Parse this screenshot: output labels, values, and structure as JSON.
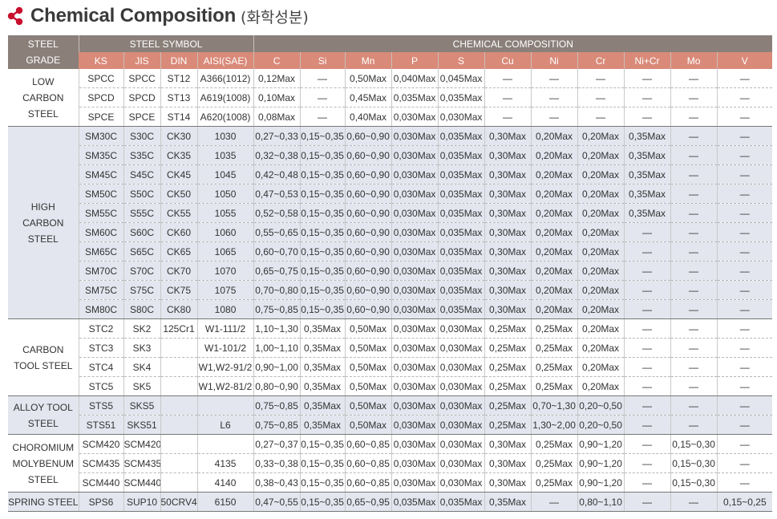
{
  "title": {
    "main": "Chemical Composition",
    "sub": "(화학성분)"
  },
  "header": {
    "steel_grade": [
      "STEEL",
      "GRADE"
    ],
    "steel_symbol": "STEEL SYMBOL",
    "chemical_composition": "CHEMICAL COMPOSITION",
    "columns": [
      "KS",
      "JIS",
      "DIN",
      "AISI(SAE)",
      "C",
      "Si",
      "Mn",
      "P",
      "S",
      "Cu",
      "Ni",
      "Cr",
      "Ni+Cr",
      "Mo",
      "V"
    ]
  },
  "groups": [
    {
      "grade": [
        "LOW",
        "CARBON",
        "STEEL"
      ],
      "shade": false,
      "rows": [
        [
          "SPCC",
          "SPCC",
          "ST12",
          "A366(1012)",
          "0,12Max",
          "—",
          "0,50Max",
          "0,040Max",
          "0,045Max",
          "—",
          "—",
          "—",
          "—",
          "—",
          "—"
        ],
        [
          "SPCD",
          "SPCD",
          "ST13",
          "A619(1008)",
          "0,10Max",
          "—",
          "0,45Max",
          "0,035Max",
          "0,035Max",
          "—",
          "—",
          "—",
          "—",
          "—",
          "—"
        ],
        [
          "SPCE",
          "SPCE",
          "ST14",
          "A620(1008)",
          "0,08Max",
          "—",
          "0,40Max",
          "0,030Max",
          "0,030Max",
          "—",
          "—",
          "—",
          "—",
          "—",
          "—"
        ]
      ]
    },
    {
      "grade": [
        "HIGH",
        "CARBON",
        "STEEL"
      ],
      "shade": true,
      "rows": [
        [
          "SM30C",
          "S30C",
          "CK30",
          "1030",
          "0,27~0,33",
          "0,15~0,35",
          "0,60~0,90",
          "0,030Max",
          "0,035Max",
          "0,30Max",
          "0,20Max",
          "0,20Max",
          "0,35Max",
          "—",
          "—"
        ],
        [
          "SM35C",
          "S35C",
          "CK35",
          "1035",
          "0,32~0,38",
          "0,15~0,35",
          "0,60~0,90",
          "0,030Max",
          "0,035Max",
          "0,30Max",
          "0,20Max",
          "0,20Max",
          "0,35Max",
          "—",
          "—"
        ],
        [
          "SM45C",
          "S45C",
          "CK45",
          "1045",
          "0,42~0,48",
          "0,15~0,35",
          "0,60~0,90",
          "0,030Max",
          "0,035Max",
          "0,30Max",
          "0,20Max",
          "0,20Max",
          "0,35Max",
          "—",
          "—"
        ],
        [
          "SM50C",
          "S50C",
          "CK50",
          "1050",
          "0,47~0,53",
          "0,15~0,35",
          "0,60~0,90",
          "0,030Max",
          "0,035Max",
          "0,30Max",
          "0,20Max",
          "0,20Max",
          "0,35Max",
          "—",
          "—"
        ],
        [
          "SM55C",
          "S55C",
          "CK55",
          "1055",
          "0,52~0,58",
          "0,15~0,35",
          "0,60~0,90",
          "0,030Max",
          "0,035Max",
          "0,30Max",
          "0,20Max",
          "0,20Max",
          "0,35Max",
          "—",
          "—"
        ],
        [
          "SM60C",
          "S60C",
          "CK60",
          "1060",
          "0,55~0,65",
          "0,15~0,35",
          "0,60~0,90",
          "0,030Max",
          "0,035Max",
          "0,30Max",
          "0,20Max",
          "0,20Max",
          "—",
          "—",
          "—"
        ],
        [
          "SM65C",
          "S65C",
          "CK65",
          "1065",
          "0,60~0,70",
          "0,15~0,35",
          "0,60~0,90",
          "0,030Max",
          "0,035Max",
          "0,30Max",
          "0,20Max",
          "0,20Max",
          "—",
          "—",
          "—"
        ],
        [
          "SM70C",
          "S70C",
          "CK70",
          "1070",
          "0,65~0,75",
          "0,15~0,35",
          "0,60~0,90",
          "0,030Max",
          "0,035Max",
          "0,30Max",
          "0,20Max",
          "0,20Max",
          "—",
          "—",
          "—"
        ],
        [
          "SM75C",
          "S75C",
          "CK75",
          "1075",
          "0,70~0,80",
          "0,15~0,35",
          "0,60~0,90",
          "0,030Max",
          "0,035Max",
          "0,30Max",
          "0,20Max",
          "0,20Max",
          "—",
          "—",
          "—"
        ],
        [
          "SM80C",
          "S80C",
          "CK80",
          "1080",
          "0,75~0,85",
          "0,15~0,35",
          "0,60~0,90",
          "0,030Max",
          "0,035Max",
          "0,30Max",
          "0,20Max",
          "0,20Max",
          "—",
          "—",
          "—"
        ]
      ]
    },
    {
      "grade": [
        "CARBON",
        "TOOL STEEL"
      ],
      "shade": false,
      "rows": [
        [
          "STC2",
          "SK2",
          "125Cr1",
          "W1-111/2",
          "1,10~1,30",
          "0,35Max",
          "0,50Max",
          "0,030Max",
          "0,030Max",
          "0,25Max",
          "0,25Max",
          "0,20Max",
          "—",
          "—",
          "—"
        ],
        [
          "STC3",
          "SK3",
          "",
          "W1-101/2",
          "1,00~1,10",
          "0,35Max",
          "0,50Max",
          "0,030Max",
          "0,030Max",
          "0,25Max",
          "0,25Max",
          "0,20Max",
          "—",
          "—",
          "—"
        ],
        [
          "STC4",
          "SK4",
          "",
          "W1,W2-91/2",
          "0,90~1,00",
          "0,35Max",
          "0,50Max",
          "0,030Max",
          "0,030Max",
          "0,25Max",
          "0,25Max",
          "0,20Max",
          "—",
          "—",
          "—"
        ],
        [
          "STC5",
          "SK5",
          "",
          "W1,W2-81/2",
          "0,80~0,90",
          "0,35Max",
          "0,50Max",
          "0,030Max",
          "0,030Max",
          "0,25Max",
          "0,25Max",
          "0,20Max",
          "—",
          "—",
          "—"
        ]
      ]
    },
    {
      "grade": [
        "ALLOY TOOL",
        "STEEL"
      ],
      "shade": true,
      "rows": [
        [
          "STS5",
          "SKS5",
          "",
          "",
          "0,75~0,85",
          "0,35Max",
          "0,50Max",
          "0,030Max",
          "0,030Max",
          "0,25Max",
          "0,70~1,30",
          "0,20~0,50",
          "—",
          "—",
          "—"
        ],
        [
          "STS51",
          "SKS51",
          "",
          "L6",
          "0,75~0,85",
          "0,35Max",
          "0,50Max",
          "0,030Max",
          "0,030Max",
          "0,25Max",
          "1,30~2,00",
          "0,20~0,50",
          "—",
          "—",
          "—"
        ]
      ]
    },
    {
      "grade": [
        "CHOROMIUM",
        "MOLYBENUM",
        "STEEL"
      ],
      "shade": false,
      "rows": [
        [
          "SCM420",
          "SCM420",
          "",
          "",
          "0,27~0,37",
          "0,15~0,35",
          "0,60~0,85",
          "0,030Max",
          "0,030Max",
          "0,30Max",
          "0,25Max",
          "0,90~1,20",
          "—",
          "0,15~0,30",
          "—"
        ],
        [
          "SCM435",
          "SCM435",
          "",
          "4135",
          "0,33~0,38",
          "0,15~0,35",
          "0,60~0,85",
          "0,030Max",
          "0,030Max",
          "0,30Max",
          "0,25Max",
          "0,90~1,20",
          "—",
          "0,15~0,30",
          "—"
        ],
        [
          "SCM440",
          "SCM440",
          "",
          "4140",
          "0,38~0,43",
          "0,15~0,35",
          "0,60~0,85",
          "0,030Max",
          "0,030Max",
          "0,30Max",
          "0,25Max",
          "0,90~1,20",
          "—",
          "0,15~0,30",
          "—"
        ]
      ]
    },
    {
      "grade": [
        "SPRING STEEL"
      ],
      "shade": true,
      "rows": [
        [
          "SPS6",
          "SUP10",
          "50CRV4",
          "6150",
          "0,47~0,55",
          "0,15~0,35",
          "0,65~0,95",
          "0,035Max",
          "0,035Max",
          "0,35Max",
          "—",
          "0,80~1,10",
          "—",
          "—",
          "0,15~0,25"
        ]
      ]
    }
  ],
  "colors": {
    "header_gray": "#8a8079",
    "header_salmon": "#d98a78",
    "row_shade": "#e3e6ef",
    "logo": "#c8102e"
  },
  "icons": {
    "logo": "red-molecule-icon"
  }
}
